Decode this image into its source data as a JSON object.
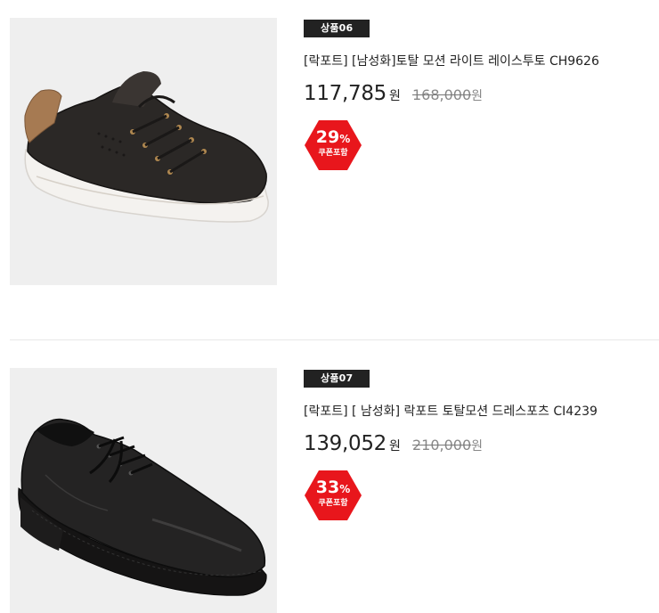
{
  "products": [
    {
      "tag": "상품06",
      "name": "[락포트] [남성화]토탈 모션 라이트 레이스투토 CH9626",
      "price": "117,785",
      "currency": "원",
      "original_price": "168,000",
      "original_currency": "원",
      "discount_number": "29",
      "discount_unit": "%",
      "coupon_label": "쿠폰포함",
      "image_icon": "casual-sneaker-shoe"
    },
    {
      "tag": "상품07",
      "name": "[락포트]  [ 남성화] 락포트 토탈모션 드레스포츠 CI4239",
      "price": "139,052",
      "currency": "원",
      "original_price": "210,000",
      "original_currency": "원",
      "discount_number": "33",
      "discount_unit": "%",
      "coupon_label": "쿠폰포함",
      "image_icon": "dress-derby-shoe"
    }
  ],
  "colors": {
    "badge_red": "#e8161c",
    "tag_bg": "#222222",
    "thumb_bg": "#efefef"
  }
}
